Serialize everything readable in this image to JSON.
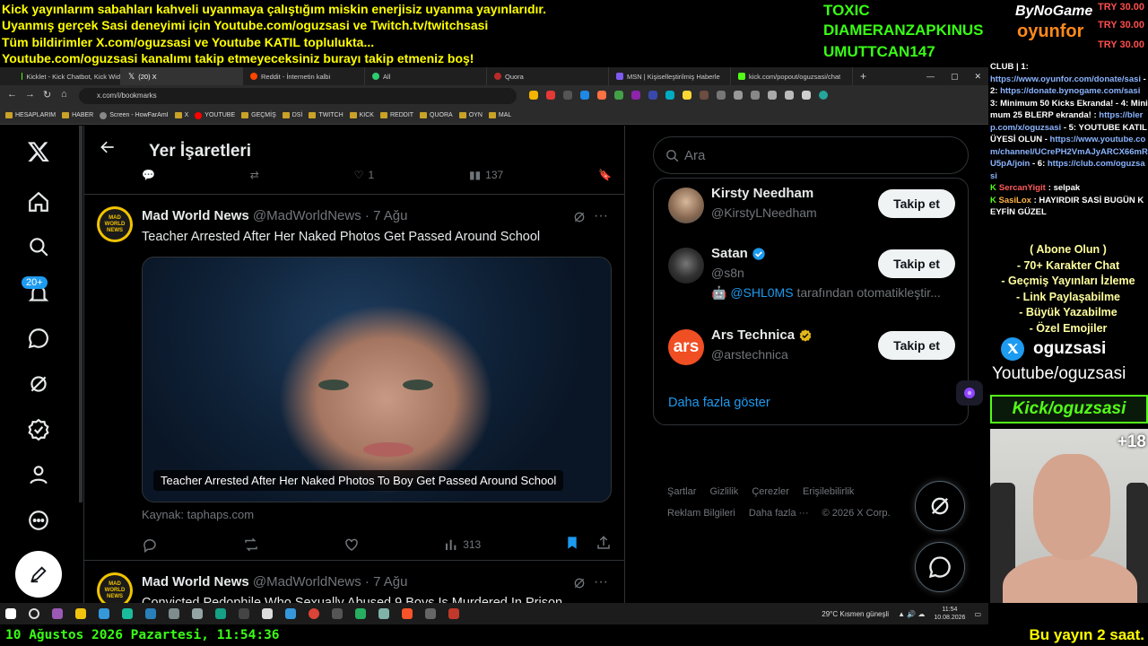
{
  "overlay": {
    "lines": [
      "Kick yayınlarım sabahları kahveli uyanmaya çalıştığım miskin enerjisiz uyanma yayınlarıdır.",
      "Uyanmış gerçek Sasi deneyimi için Youtube.com/oguzsasi ve Twitch.tv/twitchsasi",
      "Tüm bildirimler X.com/oguzsasi ve Youtube KATIL toplulukta...",
      "Youtube.com/oguzsasi kanalımı takip etmeyeceksiniz burayı takip etmeniz boş!"
    ],
    "names": [
      "TOXIC",
      "DIAMERANZAPKINUS",
      "UMUTTCAN147"
    ],
    "logo_top": "ByNoGame",
    "logo_bottom": "oyunfor",
    "donations": [
      "TRY 30.00",
      "TRY 30.00",
      "TRY 30.00"
    ],
    "colors": {
      "yellow": "#ffff00",
      "green": "#39ff14"
    }
  },
  "browser": {
    "tabs": [
      {
        "label": "Kicklet - Kick Chatbot, Kick Wid",
        "active": false
      },
      {
        "label": "(20) X",
        "active": true
      },
      {
        "label": "Reddit - İnternetin kalbi",
        "active": false
      },
      {
        "label": "All",
        "active": false
      },
      {
        "label": "Quora",
        "active": false
      },
      {
        "label": "MSN | Kişiselleştirilmiş Haberle",
        "active": false
      },
      {
        "label": "kick.com/popout/oguzsasi/chat",
        "active": false
      }
    ],
    "url": "x.com/i/bookmarks",
    "bookmarks": [
      "HESAPLARIM",
      "HABER",
      "Screen - HowFarAmI",
      "X",
      "YOUTUBE",
      "GEÇMİŞ",
      "DSİ",
      "TWITCH",
      "KICK",
      "REDDIT",
      "QUORA",
      "OYN",
      "MAL"
    ]
  },
  "x": {
    "header_title": "Yer İşaretleri",
    "notifications_badge": "20+",
    "prev_tweet_actions": {
      "likes": "1",
      "views": "137"
    },
    "tweets": [
      {
        "name": "Mad World News",
        "handle": "@MadWorldNews",
        "date": "· 7 Ağu",
        "text": "Teacher Arrested After Her Naked Photos Get Passed Around School",
        "media_caption": "Teacher Arrested After Her Naked Photos To Boy Get Passed Around School",
        "source": "Kaynak: taphaps.com",
        "views": "313",
        "avatar_text": "MAD WORLD NEWS"
      },
      {
        "name": "Mad World News",
        "handle": "@MadWorldNews",
        "date": "· 7 Ağu",
        "text": "Convicted Pedophile Who Sexually Abused 9 Boys Is Murdered In Prison",
        "avatar_text": "MAD WORLD NEWS"
      }
    ],
    "search_placeholder": "Ara",
    "who_to_follow": [
      {
        "name": "Kirsty Needham",
        "handle": "@KirstyLNeedham",
        "verified": false,
        "button": "Takip et"
      },
      {
        "name": "Satan",
        "handle": "@s8n",
        "verified": true,
        "button": "Takip et",
        "note_user": "@SHL0MS",
        "note_rest": " tarafından otomatikleştir..."
      },
      {
        "name": "Ars Technica",
        "handle": "@arstechnica",
        "verified": true,
        "button": "Takip et",
        "avatar_text": "ars"
      }
    ],
    "show_more": "Daha fazla göster",
    "footer": [
      "Şartlar",
      "Gizlilik",
      "Çerezler",
      "Erişilebilirlik",
      "Reklam Bilgileri",
      "Daha fazla ···",
      "© 2026 X Corp."
    ]
  },
  "chat": {
    "lines": [
      {
        "text": "CLUB | 1:",
        "link": false
      },
      {
        "text": "https://www.oyunfor.com/donate/sasi",
        "link": true
      },
      {
        "text": " - 2: ",
        "link": false
      },
      {
        "text": "https://donate.bynogame.com/sasi",
        "link": true
      },
      {
        "text": " 3: Minimum 50 Kicks Ekranda! - 4: Minimum 25 BLERP ekranda! : ",
        "link": false
      },
      {
        "text": "https://blerp.com/x/oguzsasi",
        "link": true
      },
      {
        "text": " - 5: YOUTUBE KATIL ÜYESİ OLUN - ",
        "link": false
      },
      {
        "text": "https://www.youtube.com/channel/UCrePH2VmAJyARCX66mRU5pA/join",
        "link": true
      },
      {
        "text": " - 6: ",
        "link": false
      },
      {
        "text": "https://club.com/oguzsasi",
        "link": true
      }
    ],
    "messages": [
      {
        "user": "SercanYigit",
        "text": " : selpak",
        "color": "#ff5b5b"
      },
      {
        "user": "SasiLox",
        "text": " : HAYIRDIR SASİ BUGÜN KEYFİN GÜZEL",
        "color": "#ffb347"
      }
    ],
    "abone": [
      "( Abone Olun )",
      "- 70+ Karakter Chat",
      "- Geçmiş Yayınları İzleme",
      "- Link Paylaşabilme",
      "- Büyük Yazabilme",
      "- Özel Emojiler"
    ],
    "social_x": "oguzsasi",
    "social_yt": "Youtube/oguzsasi",
    "kick": "Kick/oguzsasi",
    "cam_count": "+18"
  },
  "taskbar": {
    "weather": "29°C  Kısmen güneşli",
    "time": "11:54",
    "date": "10.08.2026"
  },
  "bottom": {
    "date_text": "10 Ağustos 2026 Pazartesi, 11:54:36",
    "yayin": "Bu yayın 2 saat."
  }
}
